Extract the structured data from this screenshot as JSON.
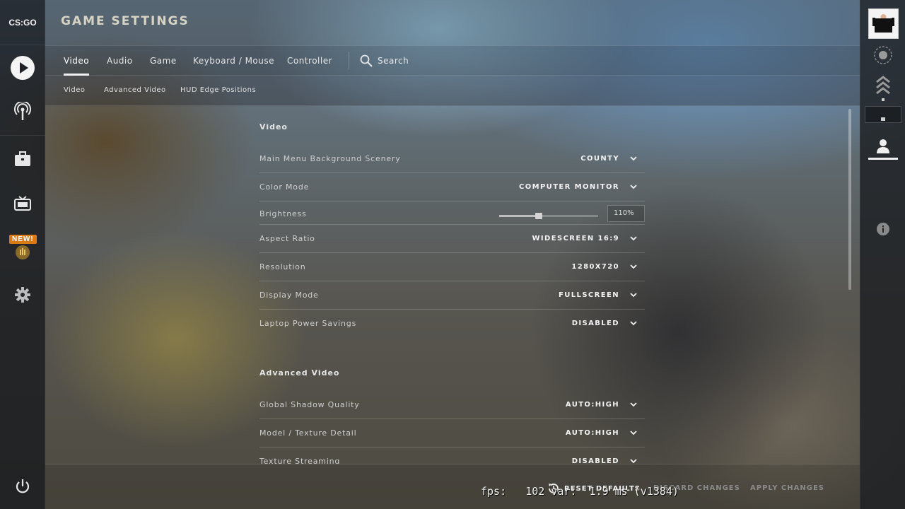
{
  "app": {
    "logo": "CS:GO"
  },
  "header": {
    "title": "GAME SETTINGS"
  },
  "tabs": [
    {
      "label": "Video",
      "active": true
    },
    {
      "label": "Audio"
    },
    {
      "label": "Game"
    },
    {
      "label": "Keyboard / Mouse"
    },
    {
      "label": "Controller"
    }
  ],
  "search": {
    "label": "Search"
  },
  "subtabs": [
    {
      "label": "Video"
    },
    {
      "label": "Advanced Video"
    },
    {
      "label": "HUD Edge Positions"
    }
  ],
  "leftnav": {
    "items": [
      {
        "icon": "play-icon"
      },
      {
        "icon": "broadcast-icon"
      },
      {
        "icon": "inventory-briefcase-icon"
      },
      {
        "icon": "tv-watch-icon"
      },
      {
        "icon": "operation-coin-icon",
        "badge": "NEW!"
      },
      {
        "icon": "gear-icon"
      },
      {
        "icon": "power-icon"
      }
    ]
  },
  "sections": {
    "video": {
      "title": "Video",
      "rows": [
        {
          "label": "Main Menu Background Scenery",
          "value": "COUNTY"
        },
        {
          "label": "Color Mode",
          "value": "COMPUTER MONITOR"
        },
        {
          "label": "Brightness",
          "value": "110%",
          "slider_fraction": 0.4
        },
        {
          "label": "Aspect Ratio",
          "value": "WIDESCREEN 16:9"
        },
        {
          "label": "Resolution",
          "value": "1280X720"
        },
        {
          "label": "Display Mode",
          "value": "FULLSCREEN"
        },
        {
          "label": "Laptop Power Savings",
          "value": "DISABLED"
        }
      ]
    },
    "advanced": {
      "title": "Advanced Video",
      "rows": [
        {
          "label": "Global Shadow Quality",
          "value": "AUTO:HIGH"
        },
        {
          "label": "Model / Texture Detail",
          "value": "AUTO:HIGH"
        },
        {
          "label": "Texture Streaming",
          "value": "DISABLED"
        }
      ]
    }
  },
  "footer": {
    "reset": "RESET DEFAULTS",
    "discard": "DISCARD CHANGES",
    "apply": "APPLY CHANGES"
  },
  "overlay": {
    "fps_text": "fps:   102 var:  1.9 ms (v1384)"
  },
  "colors": {
    "accent_orange": "#d97a15",
    "disabled_text": "#8a8a8a",
    "text": "#f2f2f2"
  }
}
